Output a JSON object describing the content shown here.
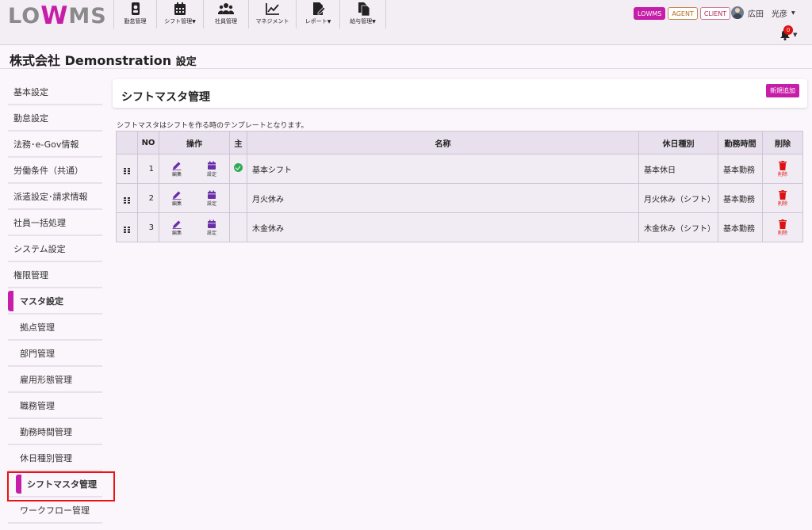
{
  "header": {
    "logo": {
      "prefix": "LO",
      "w": "W",
      "suffix": "MS"
    },
    "nav": [
      {
        "label": "勤怠管理",
        "icon": "id-card-icon",
        "caret": false
      },
      {
        "label": "シフト管理",
        "icon": "calendar-icon",
        "caret": true
      },
      {
        "label": "社員管理",
        "icon": "users-icon",
        "caret": false
      },
      {
        "label": "マネジメント",
        "icon": "line-chart-icon",
        "caret": false
      },
      {
        "label": "レポート",
        "icon": "report-icon",
        "caret": true
      },
      {
        "label": "給与管理",
        "icon": "documents-icon",
        "caret": true
      }
    ],
    "badges": [
      "LOWMS",
      "AGENT",
      "CLIENT"
    ],
    "user_name": "広田　光彦",
    "notification_count": "0"
  },
  "page_title": {
    "company": "株式会社 Demonstration",
    "suffix": "設定"
  },
  "sidebar": {
    "items": [
      "基本設定",
      "勤怠設定",
      "法務･e-Gov情報",
      "労働条件（共通）",
      "派遣設定･請求情報",
      "社員一括処理",
      "システム設定",
      "権限管理",
      "マスタ設定",
      "拠点管理",
      "部門管理",
      "雇用形態管理",
      "職務管理",
      "勤務時間管理",
      "休日種別管理",
      "シフトマスタ管理",
      "ワークフロー管理"
    ]
  },
  "main": {
    "title": "シフトマスタ管理",
    "add_button": "新規追加",
    "note": "シフトマスタはシフトを作る時のテンプレートとなります。",
    "table": {
      "headers": {
        "no": "NO",
        "ops": "操作",
        "main": "主",
        "name": "名称",
        "holiday": "休日種別",
        "work": "勤務時間",
        "delete": "削除"
      },
      "edit_label": "編集",
      "setting_label": "設定",
      "delete_label": "削除",
      "rows": [
        {
          "no": "1",
          "main": true,
          "name": "基本シフト",
          "holiday": "基本休日",
          "work": "基本勤務"
        },
        {
          "no": "2",
          "main": false,
          "name": "月火休み",
          "holiday": "月火休み（シフト）",
          "work": "基本勤務"
        },
        {
          "no": "3",
          "main": false,
          "name": "木金休み",
          "holiday": "木金休み（シフト）",
          "work": "基本勤務"
        }
      ]
    }
  },
  "colors": {
    "accent": "#c61ea8",
    "danger": "#dd1111",
    "success": "#2eaa55",
    "icon_purple": "#6a2fa8"
  }
}
